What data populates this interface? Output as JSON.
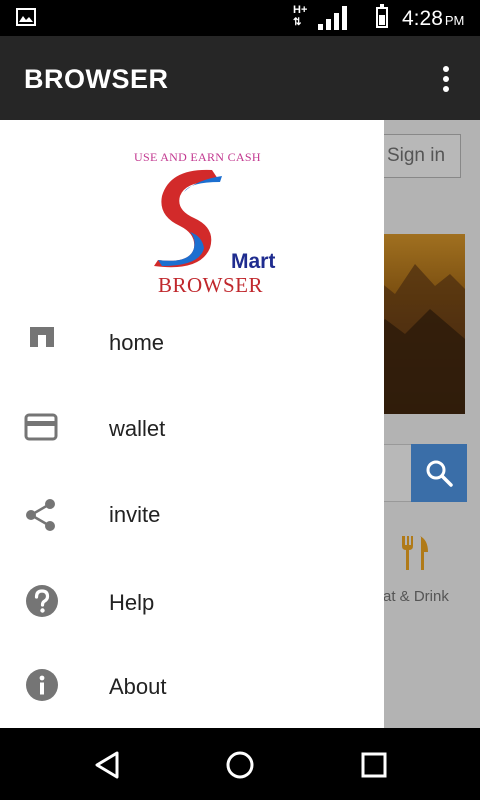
{
  "status_bar": {
    "network_type": "H+",
    "time": "4:28",
    "ampm": "PM"
  },
  "app_bar": {
    "title": "BROWSER",
    "overflow_icon": "more-vert-icon"
  },
  "background_page": {
    "sign_in_label": "Sign in",
    "category_label": "at & Drink",
    "accent_color": "#3a6ea8"
  },
  "drawer": {
    "logo": {
      "tagline": "USE AND EARN CASH",
      "mart": "Mart",
      "browser": "BROWSER"
    },
    "menu": [
      {
        "label": "home",
        "icon": "home-icon"
      },
      {
        "label": "wallet",
        "icon": "wallet-icon"
      },
      {
        "label": "invite",
        "icon": "share-icon"
      },
      {
        "label": "Help",
        "icon": "help-icon"
      },
      {
        "label": "About",
        "icon": "info-icon"
      }
    ]
  },
  "nav_bar": {
    "back": "back-icon",
    "home": "home-circle-icon",
    "recents": "recents-icon"
  }
}
